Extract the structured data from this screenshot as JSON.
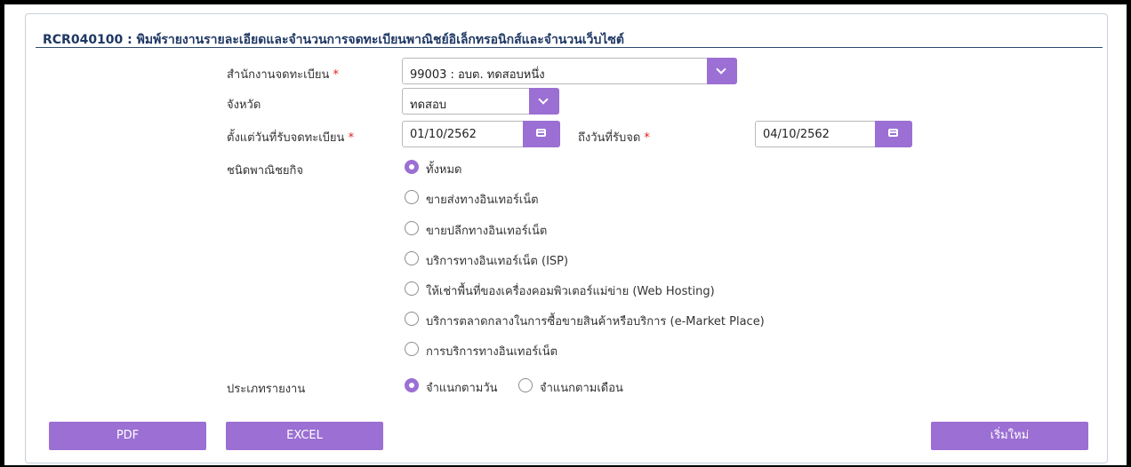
{
  "header": {
    "title": "RCR040100 : พิมพ์รายงานรายละเอียดและจำนวนการจดทะเบียนพาณิชย์อิเล็กทรอนิกส์และจำนวนเว็บไซต์"
  },
  "form": {
    "office": {
      "label": "สำนักงานจดทะเบียน",
      "required": "*",
      "value": "99003 : อบต. ทดสอบหนึ่ง"
    },
    "province": {
      "label": "จังหวัด",
      "value": "ทดสอบ"
    },
    "from_date": {
      "label": "ตั้งแต่วันที่รับจดทะเบียน",
      "required": "*",
      "value": "01/10/2562"
    },
    "to_date": {
      "label": "ถึงวันที่รับจด",
      "required": "*",
      "value": "04/10/2562"
    },
    "business_type": {
      "label": "ชนิดพาณิชยกิจ",
      "options": [
        {
          "label": "ทั้งหมด",
          "selected": true
        },
        {
          "label": "ขายส่งทางอินเทอร์เน็ต",
          "selected": false
        },
        {
          "label": "ขายปลีกทางอินเทอร์เน็ต",
          "selected": false
        },
        {
          "label": "บริการทางอินเทอร์เน็ต (ISP)",
          "selected": false
        },
        {
          "label": "ให้เช่าพื้นที่ของเครื่องคอมพิวเตอร์แม่ข่าย (Web Hosting)",
          "selected": false
        },
        {
          "label": "บริการตลาดกลางในการซื้อขายสินค้าหรือบริการ (e-Market Place)",
          "selected": false
        },
        {
          "label": "การบริการทางอินเทอร์เน็ต",
          "selected": false
        }
      ]
    },
    "report_type": {
      "label": "ประเภทรายงาน",
      "options": [
        {
          "label": "จำแนกตามวัน",
          "selected": true
        },
        {
          "label": "จำแนกตามเดือน",
          "selected": false
        }
      ]
    }
  },
  "buttons": {
    "pdf": "PDF",
    "excel": "EXCEL",
    "reset": "เริ่มใหม่"
  },
  "colors": {
    "accent": "#9b6fd3",
    "title": "#1f3864",
    "required": "#e02020"
  }
}
